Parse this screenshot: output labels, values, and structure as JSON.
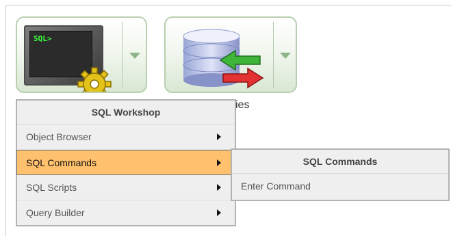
{
  "tiles": {
    "sql_workshop": {
      "prompt": "SQL>"
    },
    "utilities": {
      "label_visible": "ies"
    }
  },
  "menu": {
    "title": "SQL Workshop",
    "items": [
      {
        "label": "Object Browser",
        "has_submenu": true
      },
      {
        "label": "SQL Commands",
        "has_submenu": true,
        "active": true
      },
      {
        "label": "SQL Scripts",
        "has_submenu": true
      },
      {
        "label": "Query Builder",
        "has_submenu": true
      }
    ]
  },
  "submenu": {
    "title": "SQL Commands",
    "items": [
      {
        "label": "Enter Command"
      }
    ]
  },
  "colors": {
    "active_item": "#ffc16d",
    "prompt_text": "#38ff38",
    "tile_dropdown_arrow": "#8db58a"
  }
}
